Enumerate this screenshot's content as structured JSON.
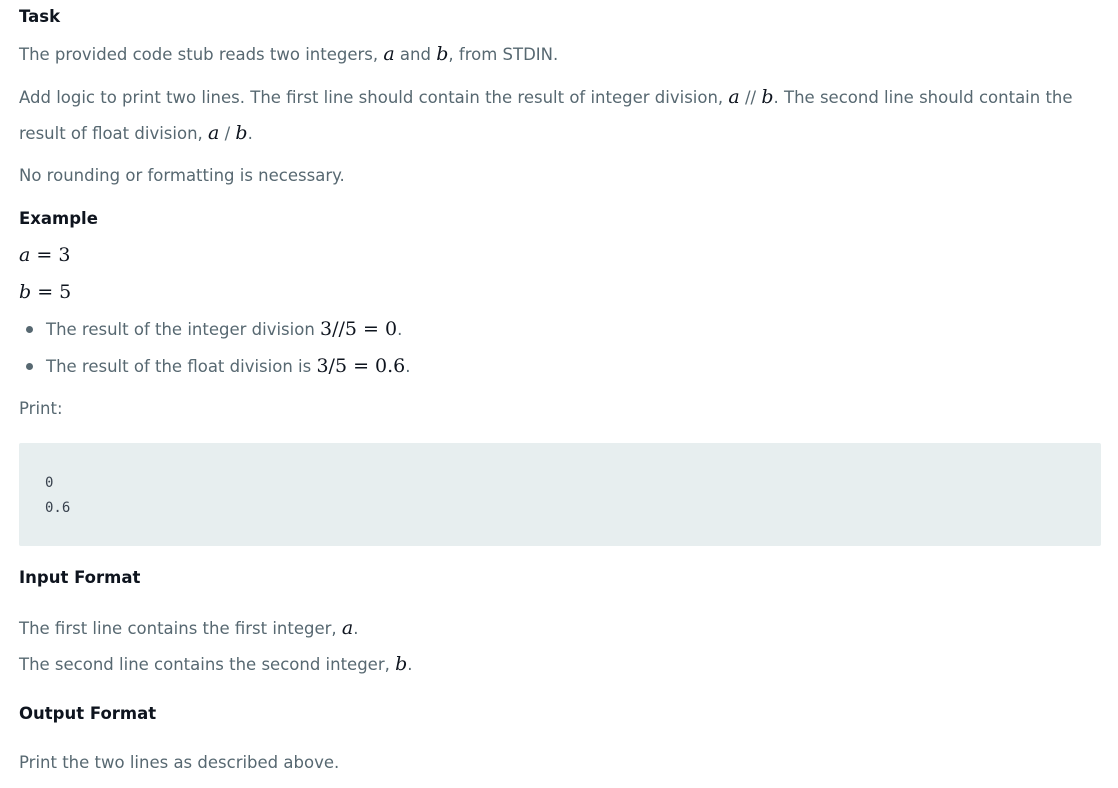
{
  "task": {
    "heading": "Task",
    "p1": {
      "pre": "The provided code stub reads two integers, ",
      "a": "a",
      "mid": " and ",
      "b": "b",
      "post": ", from STDIN."
    },
    "p2": {
      "pre": "Add logic to print two lines. The first line should contain the result of integer division, ",
      "a": "a",
      "op": " // ",
      "b": "b",
      "post": ". The second line should contain the"
    },
    "p2b": {
      "pre": "result of float division, ",
      "a": "a",
      "op": " / ",
      "b": "b",
      "post": "."
    },
    "p3": "No rounding or formatting is necessary."
  },
  "example": {
    "heading": "Example",
    "a_eq": {
      "var": "a",
      "rest": " = 3"
    },
    "b_eq": {
      "var": "b",
      "rest": " = 5"
    },
    "bullets": [
      {
        "text": "The result of the integer division ",
        "math": "3//5 = 0",
        "post": "."
      },
      {
        "text": "The result of the float division is ",
        "math": "3/5 = 0.6",
        "post": "."
      }
    ],
    "print_label": "Print:",
    "output_lines": [
      "0",
      "0.6"
    ]
  },
  "input_format": {
    "heading": "Input Format",
    "l1": {
      "pre": "The first line contains the first integer, ",
      "v": "a",
      "post": "."
    },
    "l2": {
      "pre": "The second line contains the second integer, ",
      "v": "b",
      "post": "."
    }
  },
  "output_format": {
    "heading": "Output Format",
    "text": "Print the two lines as described above."
  }
}
